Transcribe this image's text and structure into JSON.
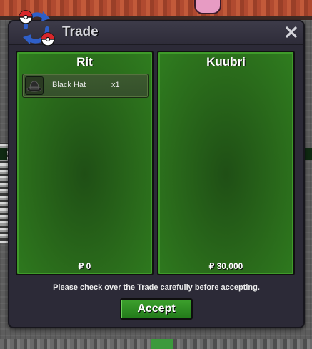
{
  "window": {
    "title": "Trade",
    "close_label": "×"
  },
  "left_panel": {
    "name": "Rit",
    "items": [
      {
        "name": "Black Hat",
        "quantity": "x1",
        "icon": "black-hat-icon"
      }
    ],
    "money": "₽ 0"
  },
  "right_panel": {
    "name": "Kuubri",
    "items": [],
    "money": "₽ 30,000"
  },
  "footer": {
    "notice": "Please check over the Trade carefully before accepting.",
    "accept_label": "Accept"
  },
  "colors": {
    "panel_green": "#2a6b1b",
    "panel_border": "#3f9b2a",
    "window_bg": "#2c2a37",
    "accept_green": "#2f8c22"
  }
}
